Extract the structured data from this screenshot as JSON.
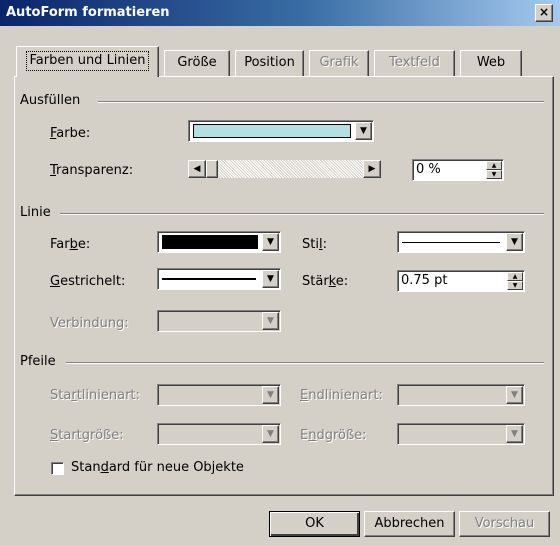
{
  "window": {
    "title": "AutoForm formatieren",
    "close_label": "×"
  },
  "tabs": [
    {
      "label": "Farben und Linien",
      "active": true,
      "enabled": true
    },
    {
      "label": "Größe",
      "active": false,
      "enabled": true
    },
    {
      "label": "Position",
      "active": false,
      "enabled": true
    },
    {
      "label": "Grafik",
      "active": false,
      "enabled": false
    },
    {
      "label": "Textfeld",
      "active": false,
      "enabled": false
    },
    {
      "label": "Web",
      "active": false,
      "enabled": true
    }
  ],
  "fill": {
    "group_label": "Ausfüllen",
    "color_label_ul": "F",
    "color_label_rest": "arbe:",
    "color_value": "#b4e0e4",
    "transparency_label_ul": "T",
    "transparency_label_rest": "ransparenz:",
    "transparency_value": "0 %",
    "transparency_fraction": 0
  },
  "line": {
    "group_label": "Linie",
    "color_label_a": "Far",
    "color_label_ul": "b",
    "color_label_b": "e:",
    "color_value": "#000000",
    "dash_label_ul": "G",
    "dash_label_rest": "estrichelt:",
    "connector_label": "Verbindung:",
    "style_label_a": "Sti",
    "style_label_ul": "l",
    "style_label_b": ":",
    "weight_label_a": "Stär",
    "weight_label_ul": "k",
    "weight_label_b": "e:",
    "weight_value": "0.75 pt"
  },
  "arrows": {
    "group_label": "Pfeile",
    "begin_style_a": "Sta",
    "begin_style_ul": "r",
    "begin_style_b": "tlinienart:",
    "end_style_ul": "E",
    "end_style_rest": "ndlinienart:",
    "begin_size_ul": "S",
    "begin_size_rest": "tartgröße:",
    "end_size_a": "E",
    "end_size_ul": "n",
    "end_size_b": "dgröße:"
  },
  "default_checkbox": {
    "label_a": "Stan",
    "label_ul": "d",
    "label_b": "ard für neue Objekte",
    "checked": false
  },
  "buttons": {
    "ok": "OK",
    "cancel": "Abbrechen",
    "preview": "Vorschau"
  },
  "icons": {
    "dropdown": "▼",
    "scroll_left": "◀",
    "scroll_right": "▶",
    "spin_up": "▲",
    "spin_down": "▼"
  }
}
